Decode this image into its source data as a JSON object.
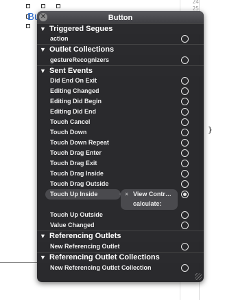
{
  "background": {
    "line_numbers": [
      "24",
      "25"
    ],
    "link_text": "Bu",
    "brace": "}"
  },
  "panel": {
    "title": "Button",
    "close_glyph": "✕",
    "sections": {
      "triggered_segues": {
        "header": "Triggered Segues",
        "items": [
          "action"
        ]
      },
      "outlet_collections": {
        "header": "Outlet Collections",
        "items": [
          "gestureRecognizers"
        ]
      },
      "sent_events": {
        "header": "Sent Events",
        "items": [
          "Did End On Exit",
          "Editing Changed",
          "Editing Did Begin",
          "Editing Did End",
          "Touch Cancel",
          "Touch Down",
          "Touch Down Repeat",
          "Touch Drag Enter",
          "Touch Drag Exit",
          "Touch Drag Inside",
          "Touch Drag Outside"
        ],
        "connected_event": {
          "label": "Touch Up Inside",
          "remove_glyph": "×",
          "target": "View Contr…",
          "action": "calculate:"
        },
        "items_after": [
          "Touch Up Outside",
          "Value Changed"
        ]
      },
      "referencing_outlets": {
        "header": "Referencing Outlets",
        "items": [
          "New Referencing Outlet"
        ]
      },
      "referencing_outlet_collections": {
        "header": "Referencing Outlet Collections",
        "items": [
          "New Referencing Outlet Collection"
        ]
      }
    },
    "disclosure_glyph": "▼"
  }
}
